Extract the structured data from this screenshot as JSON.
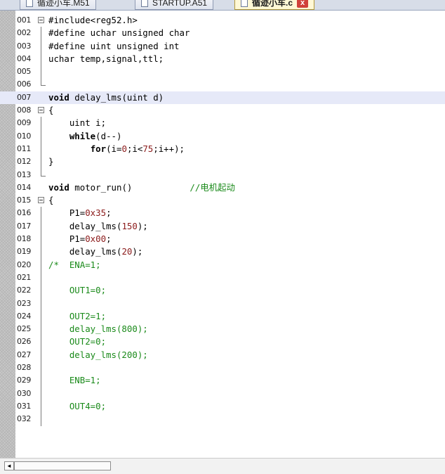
{
  "tabs": [
    {
      "label": "循迹小车.M51",
      "active": false
    },
    {
      "label": "STARTUP.A51",
      "active": false
    },
    {
      "label": "循迹小车.c",
      "active": true,
      "close": "x"
    }
  ],
  "lines": [
    {
      "n": "001",
      "fold": "open",
      "parts": [
        [
          "t",
          "#include<reg52.h>"
        ]
      ]
    },
    {
      "n": "002",
      "fold": "bar",
      "parts": [
        [
          "t",
          "#define uchar unsigned char"
        ]
      ]
    },
    {
      "n": "003",
      "fold": "bar",
      "parts": [
        [
          "t",
          "#define uint unsigned int"
        ]
      ]
    },
    {
      "n": "004",
      "fold": "bar",
      "parts": [
        [
          "t",
          "uchar temp,signal,ttl;"
        ]
      ]
    },
    {
      "n": "005",
      "fold": "bar",
      "parts": []
    },
    {
      "n": "006",
      "fold": "end",
      "parts": []
    },
    {
      "n": "007",
      "fold": "",
      "hl": true,
      "parts": [
        [
          "k",
          "void"
        ],
        [
          "t",
          " delay_lms(uint d)"
        ]
      ]
    },
    {
      "n": "008",
      "fold": "open",
      "parts": [
        [
          "t",
          "{"
        ]
      ]
    },
    {
      "n": "009",
      "fold": "bar",
      "parts": [
        [
          "t",
          "    uint i;"
        ]
      ]
    },
    {
      "n": "010",
      "fold": "bar",
      "parts": [
        [
          "t",
          "    "
        ],
        [
          "k",
          "while"
        ],
        [
          "t",
          "(d--)"
        ]
      ]
    },
    {
      "n": "011",
      "fold": "bar",
      "parts": [
        [
          "t",
          "        "
        ],
        [
          "k",
          "for"
        ],
        [
          "t",
          "(i="
        ],
        [
          "n",
          "0"
        ],
        [
          "t",
          ";i<"
        ],
        [
          "n",
          "75"
        ],
        [
          "t",
          ";i++);"
        ]
      ]
    },
    {
      "n": "012",
      "fold": "bar",
      "parts": [
        [
          "t",
          "}"
        ]
      ]
    },
    {
      "n": "013",
      "fold": "end",
      "parts": []
    },
    {
      "n": "014",
      "fold": "",
      "parts": [
        [
          "k",
          "void"
        ],
        [
          "t",
          " motor_run()           "
        ],
        [
          "c",
          "//电机起动"
        ]
      ]
    },
    {
      "n": "015",
      "fold": "open",
      "parts": [
        [
          "t",
          "{"
        ]
      ]
    },
    {
      "n": "016",
      "fold": "bar",
      "parts": [
        [
          "t",
          "    P1="
        ],
        [
          "n",
          "0x35"
        ],
        [
          "t",
          ";"
        ]
      ]
    },
    {
      "n": "017",
      "fold": "bar",
      "parts": [
        [
          "t",
          "    delay_lms("
        ],
        [
          "n",
          "150"
        ],
        [
          "t",
          ");"
        ]
      ]
    },
    {
      "n": "018",
      "fold": "bar",
      "parts": [
        [
          "t",
          "    P1="
        ],
        [
          "n",
          "0x00"
        ],
        [
          "t",
          ";"
        ]
      ]
    },
    {
      "n": "019",
      "fold": "bar",
      "parts": [
        [
          "t",
          "    delay_lms("
        ],
        [
          "n",
          "20"
        ],
        [
          "t",
          ");"
        ]
      ]
    },
    {
      "n": "020",
      "fold": "bar",
      "parts": [
        [
          "c",
          "/*  ENA=1;"
        ]
      ]
    },
    {
      "n": "021",
      "fold": "bar",
      "parts": []
    },
    {
      "n": "022",
      "fold": "bar",
      "parts": [
        [
          "c",
          "    OUT1=0;"
        ]
      ]
    },
    {
      "n": "023",
      "fold": "bar",
      "parts": []
    },
    {
      "n": "024",
      "fold": "bar",
      "parts": [
        [
          "c",
          "    OUT2=1;"
        ]
      ]
    },
    {
      "n": "025",
      "fold": "bar",
      "parts": [
        [
          "c",
          "    delay_lms(800);"
        ]
      ]
    },
    {
      "n": "026",
      "fold": "bar",
      "parts": [
        [
          "c",
          "    OUT2=0;"
        ]
      ]
    },
    {
      "n": "027",
      "fold": "bar",
      "parts": [
        [
          "c",
          "    delay_lms(200);"
        ]
      ]
    },
    {
      "n": "028",
      "fold": "bar",
      "parts": []
    },
    {
      "n": "029",
      "fold": "bar",
      "parts": [
        [
          "c",
          "    ENB=1;"
        ]
      ]
    },
    {
      "n": "030",
      "fold": "bar",
      "parts": []
    },
    {
      "n": "031",
      "fold": "bar",
      "parts": [
        [
          "c",
          "    OUT4=0;"
        ]
      ]
    },
    {
      "n": "032",
      "fold": "bar",
      "parts": []
    }
  ],
  "scroll": {
    "left_arrow": "◄"
  }
}
